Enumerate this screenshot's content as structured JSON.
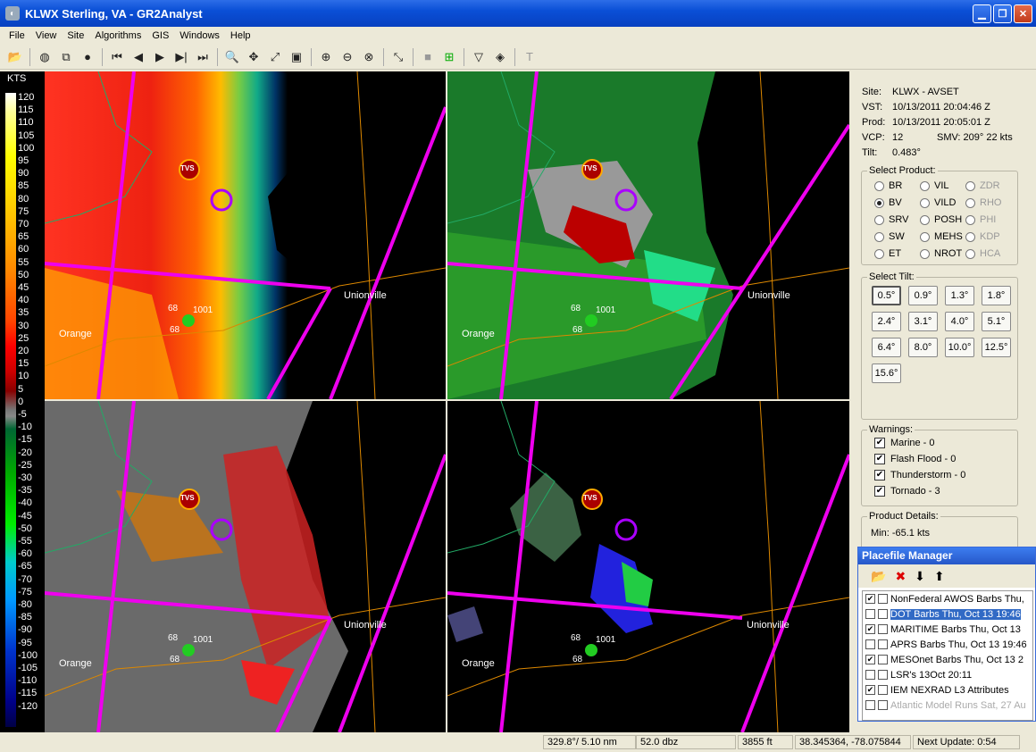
{
  "window": {
    "title": "KLWX Sterling, VA - GR2Analyst"
  },
  "menu": [
    "File",
    "View",
    "Site",
    "Algorithms",
    "GIS",
    "Windows",
    "Help"
  ],
  "legend": {
    "unit": "KTS",
    "labels": [
      "120",
      "115",
      "110",
      "105",
      "100",
      "95",
      "90",
      "85",
      "80",
      "75",
      "70",
      "65",
      "60",
      "55",
      "50",
      "45",
      "40",
      "35",
      "30",
      "25",
      "20",
      "15",
      "10",
      "5",
      "0",
      "-5",
      "-10",
      "-15",
      "-20",
      "-25",
      "-30",
      "-35",
      "-40",
      "-45",
      "-50",
      "-55",
      "-60",
      "-65",
      "-70",
      "-75",
      "-80",
      "-85",
      "-90",
      "-95",
      "-100",
      "-105",
      "-110",
      "-115",
      "-120"
    ]
  },
  "map_labels": {
    "unionville": "Unionville",
    "orange": "Orange",
    "tvs": "TVS",
    "obs_a": "68",
    "obs_b": "1001",
    "obs_c": "68"
  },
  "info": {
    "site_k": "Site:",
    "site_v": "KLWX - AVSET",
    "vst_k": "VST:",
    "vst_v": "10/13/2011  20:04:46 Z",
    "prod_k": "Prod:",
    "prod_v": "10/13/2011  20:05:01 Z",
    "vcp_k": "VCP:",
    "vcp_v": "12",
    "smv": "SMV:  209° 22 kts",
    "tilt_k": "Tilt:",
    "tilt_v": "0.483°"
  },
  "select_product": {
    "label": "Select Product:",
    "items": [
      {
        "label": "BR",
        "state": "off"
      },
      {
        "label": "VIL",
        "state": "off"
      },
      {
        "label": "ZDR",
        "state": "disabled"
      },
      {
        "label": "BV",
        "state": "on"
      },
      {
        "label": "VILD",
        "state": "off"
      },
      {
        "label": "RHO",
        "state": "disabled"
      },
      {
        "label": "SRV",
        "state": "off"
      },
      {
        "label": "POSH",
        "state": "off"
      },
      {
        "label": "PHI",
        "state": "disabled"
      },
      {
        "label": "SW",
        "state": "off"
      },
      {
        "label": "MEHS",
        "state": "off"
      },
      {
        "label": "KDP",
        "state": "disabled"
      },
      {
        "label": "ET",
        "state": "off"
      },
      {
        "label": "NROT",
        "state": "off"
      },
      {
        "label": "HCA",
        "state": "disabled"
      }
    ]
  },
  "select_tilt": {
    "label": "Select Tilt:",
    "items": [
      "0.5°",
      "0.9°",
      "1.3°",
      "1.8°",
      "2.4°",
      "3.1°",
      "4.0°",
      "5.1°",
      "6.4°",
      "8.0°",
      "10.0°",
      "12.5°",
      "15.6°"
    ],
    "selected": "0.5°"
  },
  "warnings": {
    "label": "Warnings:",
    "items": [
      "Marine - 0",
      "Flash Flood - 0",
      "Thunderstorm - 0",
      "Tornado - 3"
    ]
  },
  "product_details": {
    "label": "Product Details:",
    "min": "Min:        -65.1 kts"
  },
  "placefile": {
    "title": "Placefile Manager",
    "items": [
      {
        "label": "NonFederal AWOS Barbs Thu, ",
        "checked": true,
        "state": "normal"
      },
      {
        "label": "DOT Barbs Thu, Oct 13 19:46",
        "checked": false,
        "state": "selected"
      },
      {
        "label": "MARITIME Barbs Thu, Oct 13",
        "checked": true,
        "state": "normal"
      },
      {
        "label": "APRS Barbs Thu, Oct 13 19:46",
        "checked": false,
        "state": "normal"
      },
      {
        "label": "MESOnet Barbs Thu, Oct 13 2",
        "checked": true,
        "state": "normal"
      },
      {
        "label": "LSR's 13Oct 20:11",
        "checked": false,
        "state": "normal"
      },
      {
        "label": "IEM NEXRAD L3 Attributes",
        "checked": true,
        "state": "normal"
      },
      {
        "label": "Atlantic Model Runs Sat, 27 Au",
        "checked": false,
        "state": "disabled"
      }
    ]
  },
  "status": {
    "polar": "329.8°/ 5.10 nm",
    "value": "52.0 dbz",
    "height": "3855 ft",
    "latlon": "38.345364, -78.075844",
    "next_update": "Next Update: 0:54"
  }
}
